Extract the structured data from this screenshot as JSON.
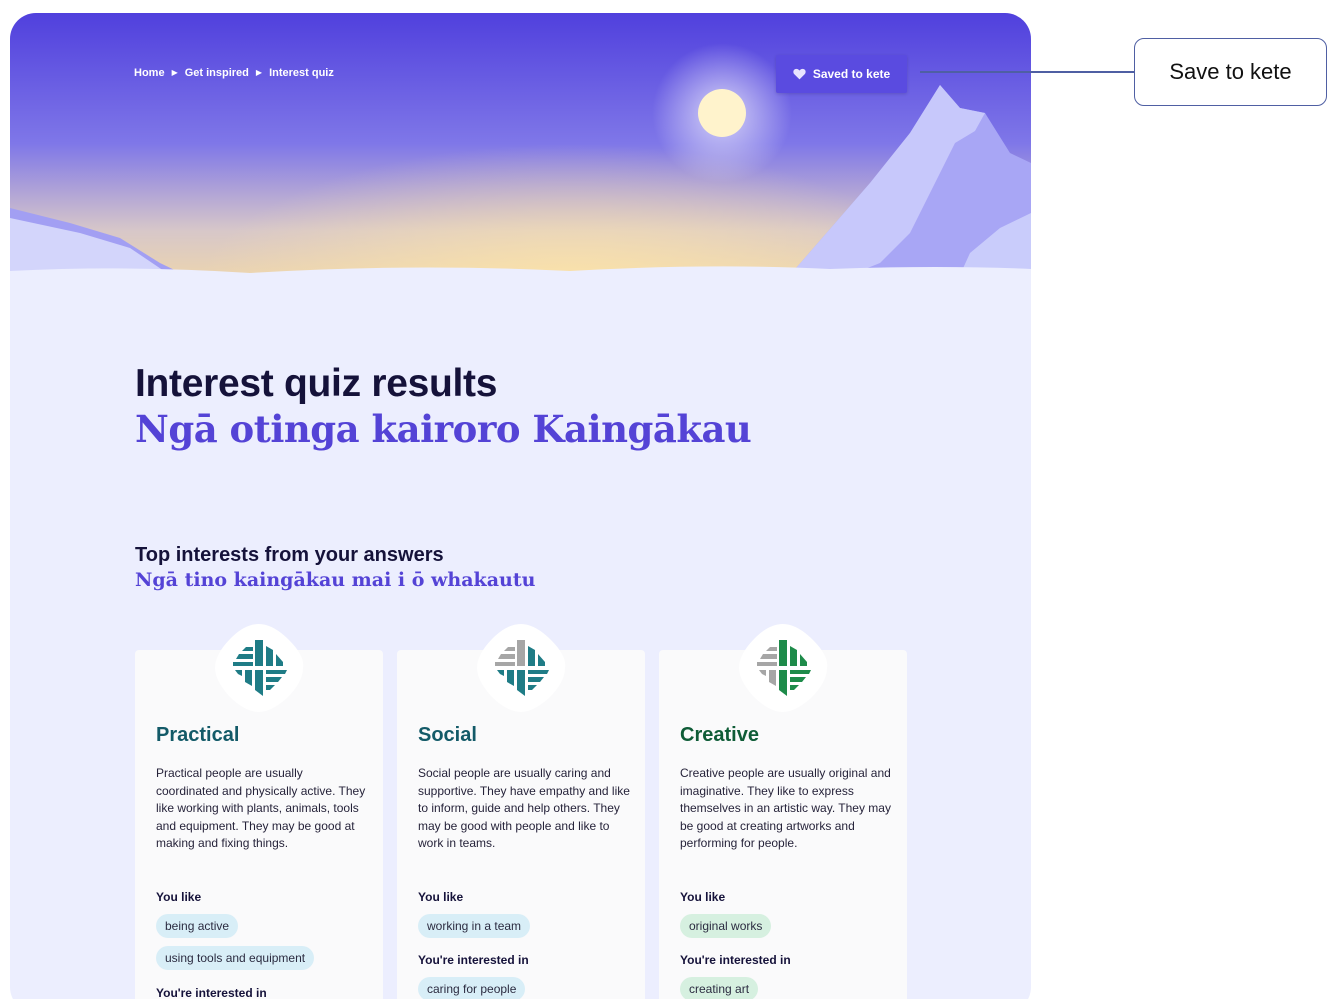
{
  "breadcrumb": {
    "items": [
      "Home",
      "Get inspired",
      "Interest quiz"
    ]
  },
  "save_button": {
    "label": "Saved to kete"
  },
  "callout": {
    "label": "Save to kete"
  },
  "heading": {
    "title_en": "Interest quiz results",
    "title_mi": "Ngā otinga kairoro Kaingākau"
  },
  "section": {
    "title_en": "Top interests from your answers",
    "title_mi": "Ngā tino kaingākau mai i ō whakautu"
  },
  "cards": [
    {
      "title": "Practical",
      "description": "Practical people are usually coordinated and physically active. They like working with plants, animals, tools and equipment. They may be good at making and fixing things.",
      "you_like_label": "You like",
      "you_like": [
        "being active",
        "using tools and equipment"
      ],
      "interested_label": "You're interested in",
      "interested": []
    },
    {
      "title": "Social",
      "description": "Social people are usually caring and supportive. They have empathy and like to inform, guide and help others. They may be good with people and like to work in teams.",
      "you_like_label": "You like",
      "you_like": [
        "working in a team"
      ],
      "interested_label": "You're interested in",
      "interested": [
        "caring for people"
      ]
    },
    {
      "title": "Creative",
      "description": "Creative people are usually original and imaginative. They like to express themselves in an artistic way. They may be good at creating artworks and performing for people.",
      "you_like_label": "You like",
      "you_like": [
        "original works"
      ],
      "interested_label": "You're interested in",
      "interested": [
        "creating art"
      ]
    }
  ],
  "icons": {
    "heart": "heart-icon",
    "breadcrumb_separator": "triangle-right-icon",
    "card_badge": "woven-pattern-icon"
  },
  "colors": {
    "accent": "#5a4be0",
    "practical": "#135a68",
    "social": "#135a68",
    "creative": "#0f5c37",
    "teal": "#1f7c86",
    "green": "#1e8b4a",
    "grey": "#a6a6a6"
  }
}
